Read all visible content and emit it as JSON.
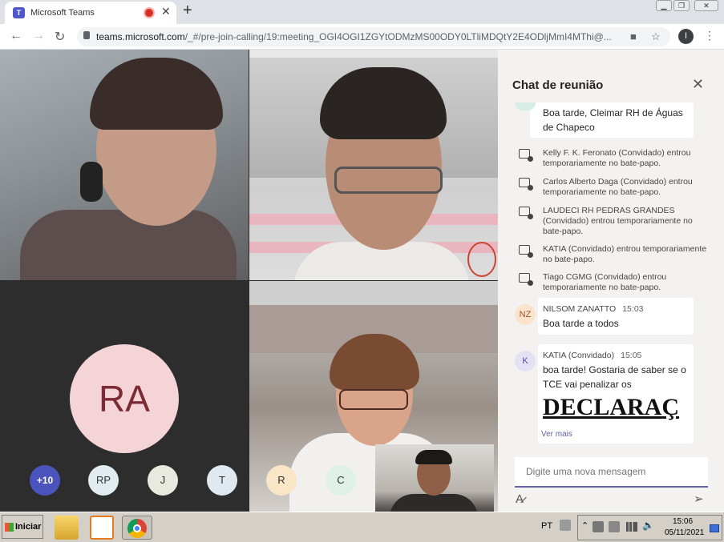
{
  "browser": {
    "tab_title": "Microsoft Teams",
    "tab_favicon_letter": "T",
    "url_host": "teams.microsoft.com",
    "url_path": "/_#/pre-join-calling/19:meeting_OGI4OGI1ZGYtODMzMS00ODY0LTliMDQtY2E4ODljMmI4MThi@...",
    "profile_initial": "I"
  },
  "grid": {
    "ra_initials": "RA",
    "overflow_count": "+10",
    "participants": [
      {
        "initials": "RP",
        "color": "#e1ecf0"
      },
      {
        "initials": "J",
        "color": "#e9eadf"
      },
      {
        "initials": "T",
        "color": "#dfe9ef"
      },
      {
        "initials": "R",
        "color": "#f8e6c6"
      },
      {
        "initials": "C",
        "color": "#dff0e8"
      }
    ]
  },
  "chat": {
    "title": "Chat de reunião",
    "first_message": "Boa tarde, Cleimar RH de Águas de Chapeco",
    "system_messages": [
      "Kelly F. K. Feronato (Convidado) entrou temporariamente no bate-papo.",
      "Carlos Alberto Daga (Convidado) entrou temporariamente no bate-papo.",
      "LAUDECI RH PEDRAS GRANDES (Convidado) entrou temporariamente no bate-papo.",
      "KATIA (Convidado) entrou temporariamente no bate-papo.",
      "Tiago CGMG (Convidado) entrou temporariamente no bate-papo."
    ],
    "messages": [
      {
        "initials": "NZ",
        "sender": "NILSOM ZANATTO",
        "time": "15:03",
        "text": "Boa tarde a todos",
        "avatar_color": "#fbe3cc",
        "avatar_fg": "#a0522d"
      },
      {
        "initials": "K",
        "sender": "KATIA (Convidado)",
        "time": "15:05",
        "text": "boa tarde! Gostaria de saber se o TCE vai penalizar os",
        "attachment_text": "DECLARAÇ",
        "see_more": "Ver mais",
        "avatar_color": "#e5e1f5",
        "avatar_fg": "#5b4aa1"
      }
    ],
    "compose_placeholder": "Digite uma nova mensagem"
  },
  "taskbar": {
    "start_label": "Iniciar",
    "language": "PT",
    "time": "15:06",
    "date": "05/11/2021"
  },
  "colors": {
    "teams_purple": "#6264a7",
    "chat_bg": "#f3f2f1",
    "grid_bg": "#292929"
  }
}
